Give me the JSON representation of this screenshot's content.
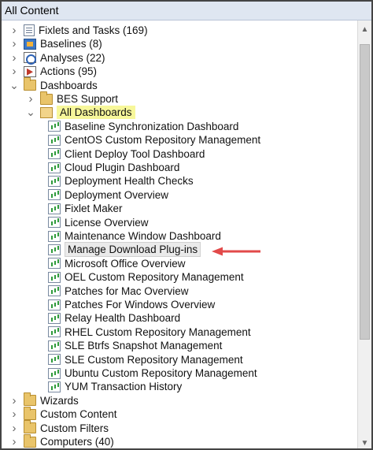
{
  "header": {
    "title": "All Content"
  },
  "tree": [
    {
      "label": "Fixlets and Tasks (169)",
      "depth": 0,
      "chevron": "right",
      "icon": "doc"
    },
    {
      "label": "Baselines (8)",
      "depth": 0,
      "chevron": "right",
      "icon": "base"
    },
    {
      "label": "Analyses (22)",
      "depth": 0,
      "chevron": "right",
      "icon": "anal"
    },
    {
      "label": "Actions (95)",
      "depth": 0,
      "chevron": "right",
      "icon": "act"
    },
    {
      "label": "Dashboards",
      "depth": 0,
      "chevron": "down",
      "icon": "folder"
    },
    {
      "label": "BES Support",
      "depth": 1,
      "chevron": "right",
      "icon": "folder"
    },
    {
      "label": "All Dashboards",
      "depth": 1,
      "chevron": "down",
      "icon": "folder-open",
      "highlight": true
    },
    {
      "label": "Baseline Synchronization Dashboard",
      "depth": 2,
      "icon": "dash"
    },
    {
      "label": "CentOS Custom Repository Management",
      "depth": 2,
      "icon": "dash"
    },
    {
      "label": "Client Deploy Tool Dashboard",
      "depth": 2,
      "icon": "dash"
    },
    {
      "label": "Cloud Plugin Dashboard",
      "depth": 2,
      "icon": "dash"
    },
    {
      "label": "Deployment Health Checks",
      "depth": 2,
      "icon": "dash"
    },
    {
      "label": "Deployment Overview",
      "depth": 2,
      "icon": "dash"
    },
    {
      "label": "Fixlet Maker",
      "depth": 2,
      "icon": "dash"
    },
    {
      "label": "License Overview",
      "depth": 2,
      "icon": "dash"
    },
    {
      "label": "Maintenance Window Dashboard",
      "depth": 2,
      "icon": "dash"
    },
    {
      "label": "Manage Download Plug-ins",
      "depth": 2,
      "icon": "dash",
      "selected": true
    },
    {
      "label": "Microsoft Office Overview",
      "depth": 2,
      "icon": "dash"
    },
    {
      "label": "OEL Custom Repository Management",
      "depth": 2,
      "icon": "dash"
    },
    {
      "label": "Patches for Mac Overview",
      "depth": 2,
      "icon": "dash"
    },
    {
      "label": "Patches For Windows Overview",
      "depth": 2,
      "icon": "dash"
    },
    {
      "label": "Relay Health Dashboard",
      "depth": 2,
      "icon": "dash"
    },
    {
      "label": "RHEL Custom Repository Management",
      "depth": 2,
      "icon": "dash"
    },
    {
      "label": "SLE Btrfs Snapshot Management",
      "depth": 2,
      "icon": "dash"
    },
    {
      "label": "SLE Custom Repository Management",
      "depth": 2,
      "icon": "dash"
    },
    {
      "label": "Ubuntu Custom Repository Management",
      "depth": 2,
      "icon": "dash"
    },
    {
      "label": "YUM Transaction History",
      "depth": 2,
      "icon": "dash"
    },
    {
      "label": "Wizards",
      "depth": 0,
      "chevron": "right",
      "icon": "folder"
    },
    {
      "label": "Custom Content",
      "depth": 0,
      "chevron": "right",
      "icon": "folder"
    },
    {
      "label": "Custom Filters",
      "depth": 0,
      "chevron": "right",
      "icon": "folder"
    },
    {
      "label": "Computers (40)",
      "depth": 0,
      "chevron": "right",
      "icon": "folder"
    }
  ],
  "scrollbar": {
    "position_fraction": 0.02,
    "visible_fraction": 0.74
  },
  "colors": {
    "highlight": "#f7f79a",
    "arrow": "#e24a4a",
    "header_bg": "#dfe6f1"
  }
}
